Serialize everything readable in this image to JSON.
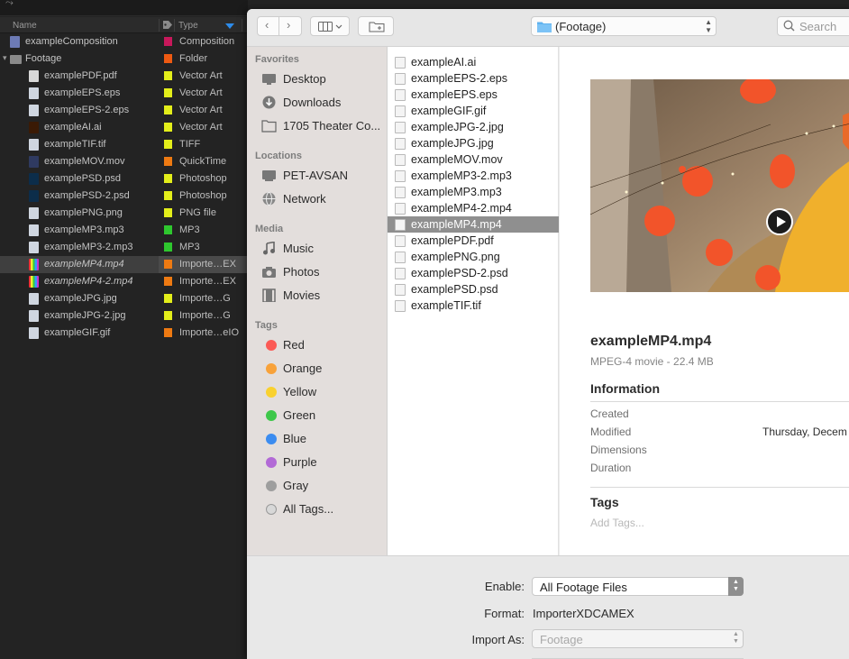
{
  "project_panel": {
    "top_glyph": "⤳",
    "columns": {
      "name": "Name",
      "type": "Type"
    },
    "items": [
      {
        "name": "exampleComposition",
        "type": "Composition",
        "label_color": "#c8185b",
        "icon": "composition-icon",
        "indent": 0,
        "italic": false,
        "selected": false
      },
      {
        "name": "Footage",
        "type": "Folder",
        "label_color": "#ee5a12",
        "icon": "folder-icon",
        "indent": 0,
        "italic": false,
        "selected": false,
        "expanded": true
      },
      {
        "name": "examplePDF.pdf",
        "type": "Vector Art",
        "label_color": "#e3ee1a",
        "icon": "pdf-icon",
        "indent": 1,
        "italic": false,
        "selected": false
      },
      {
        "name": "exampleEPS.eps",
        "type": "Vector Art",
        "label_color": "#e3ee1a",
        "icon": "eps-icon",
        "indent": 1,
        "italic": false,
        "selected": false
      },
      {
        "name": "exampleEPS-2.eps",
        "type": "Vector Art",
        "label_color": "#e3ee1a",
        "icon": "eps-icon",
        "indent": 1,
        "italic": false,
        "selected": false
      },
      {
        "name": "exampleAI.ai",
        "type": "Vector Art",
        "label_color": "#e3ee1a",
        "icon": "illustrator-icon",
        "indent": 1,
        "italic": false,
        "selected": false
      },
      {
        "name": "exampleTIF.tif",
        "type": "TIFF",
        "label_color": "#e3ee1a",
        "icon": "tif-icon",
        "indent": 1,
        "italic": false,
        "selected": false
      },
      {
        "name": "exampleMOV.mov",
        "type": "QuickTime",
        "label_color": "#ee7a12",
        "icon": "quicktime-icon",
        "indent": 1,
        "italic": false,
        "selected": false
      },
      {
        "name": "examplePSD.psd",
        "type": "Photoshop",
        "label_color": "#e3ee1a",
        "icon": "photoshop-icon",
        "indent": 1,
        "italic": false,
        "selected": false
      },
      {
        "name": "examplePSD-2.psd",
        "type": "Photoshop",
        "label_color": "#e3ee1a",
        "icon": "photoshop-icon",
        "indent": 1,
        "italic": false,
        "selected": false
      },
      {
        "name": "examplePNG.png",
        "type": "PNG file",
        "label_color": "#e3ee1a",
        "icon": "png-icon",
        "indent": 1,
        "italic": false,
        "selected": false
      },
      {
        "name": "exampleMP3.mp3",
        "type": "MP3",
        "label_color": "#2ec72e",
        "icon": "audio-icon",
        "indent": 1,
        "italic": false,
        "selected": false
      },
      {
        "name": "exampleMP3-2.mp3",
        "type": "MP3",
        "label_color": "#2ec72e",
        "icon": "audio-icon",
        "indent": 1,
        "italic": false,
        "selected": false
      },
      {
        "name": "exampleMP4.mp4",
        "type": "Importe…EX",
        "label_color": "#ee7a12",
        "icon": "video-bars-icon",
        "indent": 1,
        "italic": true,
        "selected": true
      },
      {
        "name": "exampleMP4-2.mp4",
        "type": "Importe…EX",
        "label_color": "#ee7a12",
        "icon": "video-bars-icon",
        "indent": 1,
        "italic": true,
        "selected": false
      },
      {
        "name": "exampleJPG.jpg",
        "type": "Importe…G",
        "label_color": "#e3ee1a",
        "icon": "image-file-icon",
        "indent": 1,
        "italic": false,
        "selected": false
      },
      {
        "name": "exampleJPG-2.jpg",
        "type": "Importe…G",
        "label_color": "#e3ee1a",
        "icon": "image-file-icon",
        "indent": 1,
        "italic": false,
        "selected": false
      },
      {
        "name": "exampleGIF.gif",
        "type": "Importe…eIO",
        "label_color": "#ee7a12",
        "icon": "image-file-icon",
        "indent": 1,
        "italic": false,
        "selected": false
      }
    ]
  },
  "toolbar": {
    "back_glyph": "‹",
    "forward_glyph": "›",
    "path_label": "(Footage)",
    "search_placeholder": "Search"
  },
  "sidebar": {
    "sections": {
      "favorites": "Favorites",
      "locations": "Locations",
      "media": "Media",
      "tags": "Tags"
    },
    "favorites": [
      {
        "label": "Desktop",
        "icon": "desktop-icon"
      },
      {
        "label": "Downloads",
        "icon": "downloads-icon"
      },
      {
        "label": "1705 Theater Co...",
        "icon": "folder-icon"
      }
    ],
    "locations": [
      {
        "label": "PET-AVSAN",
        "icon": "computer-icon"
      },
      {
        "label": "Network",
        "icon": "network-icon"
      }
    ],
    "media": [
      {
        "label": "Music",
        "icon": "music-icon"
      },
      {
        "label": "Photos",
        "icon": "camera-icon"
      },
      {
        "label": "Movies",
        "icon": "film-icon"
      }
    ],
    "tags": [
      {
        "label": "Red",
        "color": "#fb5a55"
      },
      {
        "label": "Orange",
        "color": "#f8a23a"
      },
      {
        "label": "Yellow",
        "color": "#f9d12f"
      },
      {
        "label": "Green",
        "color": "#3ec74a"
      },
      {
        "label": "Blue",
        "color": "#3b8cf0"
      },
      {
        "label": "Purple",
        "color": "#b26ad6"
      },
      {
        "label": "Gray",
        "color": "#9e9e9e"
      },
      {
        "label": "All Tags...",
        "color": "#d8d8d8"
      }
    ]
  },
  "file_list": {
    "selected_index": 10,
    "files": [
      "exampleAI.ai",
      "exampleEPS-2.eps",
      "exampleEPS.eps",
      "exampleGIF.gif",
      "exampleJPG-2.jpg",
      "exampleJPG.jpg",
      "exampleMOV.mov",
      "exampleMP3-2.mp3",
      "exampleMP3.mp3",
      "exampleMP4-2.mp4",
      "exampleMP4.mp4",
      "examplePDF.pdf",
      "examplePNG.png",
      "examplePSD-2.psd",
      "examplePSD.psd",
      "exampleTIF.tif"
    ],
    "resize_glyph": "||"
  },
  "preview": {
    "file_name": "exampleMP4.mp4",
    "kind": "MPEG-4 movie - 22.4 MB",
    "information_heading": "Information",
    "fields": [
      {
        "label": "Created",
        "value": ""
      },
      {
        "label": "Modified",
        "value": "Thursday, Decem"
      },
      {
        "label": "Dimensions",
        "value": ""
      },
      {
        "label": "Duration",
        "value": ""
      }
    ],
    "tags_heading": "Tags",
    "add_tags_placeholder": "Add Tags..."
  },
  "accessory": {
    "enable_label": "Enable:",
    "enable_value": "All Footage Files",
    "format_label": "Format:",
    "format_value": "ImporterXDCAMEX",
    "import_as_label": "Import As:",
    "import_as_value": "Footage"
  }
}
